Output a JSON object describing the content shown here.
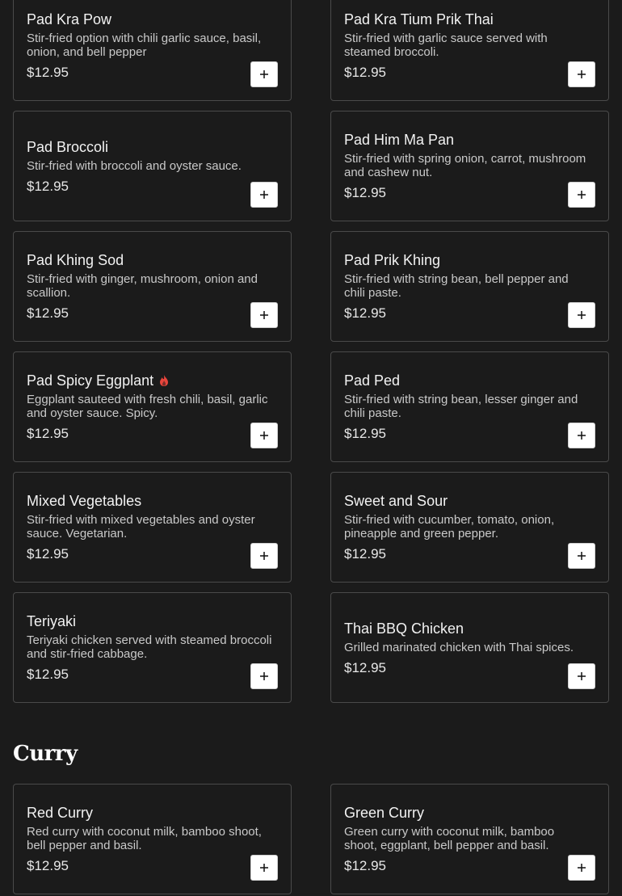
{
  "accent_color": "#e8453c",
  "sections": [
    {
      "title": "",
      "items": [
        {
          "name": "Pad Kra Pow",
          "desc": "Stir-fried option with chili garlic sauce, basil, onion, and bell pepper",
          "price": "$12.95",
          "spicy": false
        },
        {
          "name": "Pad Kra Tium Prik Thai",
          "desc": "Stir-fried with garlic sauce served with steamed broccoli.",
          "price": "$12.95",
          "spicy": false
        },
        {
          "name": "Pad Broccoli",
          "desc": "Stir-fried with broccoli and oyster sauce.",
          "price": "$12.95",
          "spicy": false
        },
        {
          "name": "Pad Him Ma Pan",
          "desc": "Stir-fried with spring onion, carrot, mushroom and cashew nut.",
          "price": "$12.95",
          "spicy": false
        },
        {
          "name": "Pad Khing Sod",
          "desc": "Stir-fried with ginger, mushroom, onion and scallion.",
          "price": "$12.95",
          "spicy": false
        },
        {
          "name": "Pad Prik Khing",
          "desc": "Stir-fried with string bean, bell pepper and chili paste.",
          "price": "$12.95",
          "spicy": false
        },
        {
          "name": "Pad Spicy Eggplant",
          "desc": "Eggplant sauteed with fresh chili, basil, garlic and oyster sauce. Spicy.",
          "price": "$12.95",
          "spicy": true
        },
        {
          "name": "Pad Ped",
          "desc": "Stir-fried with string bean, lesser ginger and chili paste.",
          "price": "$12.95",
          "spicy": false
        },
        {
          "name": "Mixed Vegetables",
          "desc": "Stir-fried with mixed vegetables and oyster sauce. Vegetarian.",
          "price": "$12.95",
          "spicy": false
        },
        {
          "name": "Sweet and Sour",
          "desc": "Stir-fried with cucumber, tomato, onion, pineapple and green pepper.",
          "price": "$12.95",
          "spicy": false
        },
        {
          "name": "Teriyaki",
          "desc": "Teriyaki chicken served with steamed broccoli and stir-fried cabbage.",
          "price": "$12.95",
          "spicy": false
        },
        {
          "name": "Thai BBQ Chicken",
          "desc": "Grilled marinated chicken with Thai spices.",
          "price": "$12.95",
          "spicy": false
        }
      ]
    },
    {
      "title": "Curry",
      "items": [
        {
          "name": "Red Curry",
          "desc": "Red curry with coconut milk, bamboo shoot, bell pepper and basil.",
          "price": "$12.95",
          "spicy": false
        },
        {
          "name": "Green Curry",
          "desc": "Green curry with coconut milk, bamboo shoot, eggplant, bell pepper and basil.",
          "price": "$12.95",
          "spicy": false
        }
      ]
    }
  ],
  "icons": {
    "add": "plus-icon",
    "spicy": "chili-flame-icon"
  }
}
